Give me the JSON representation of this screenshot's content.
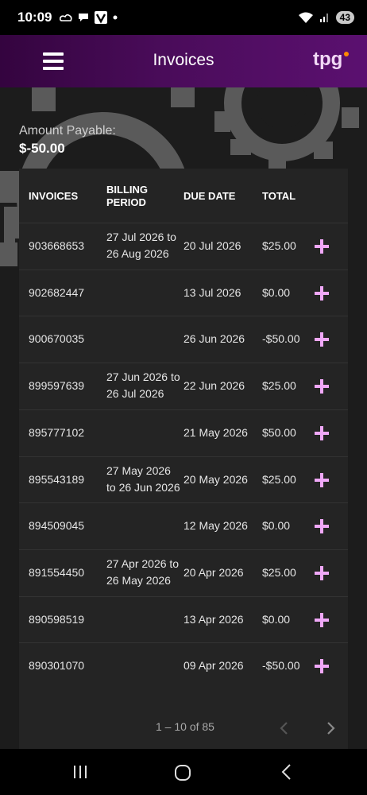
{
  "status": {
    "time": "10:09",
    "battery": "43"
  },
  "header": {
    "title": "Invoices",
    "logo_text": "tpg"
  },
  "summary": {
    "label": "Amount Payable:",
    "value": "$-50.00"
  },
  "table": {
    "headers": {
      "invoices": "INVOICES",
      "billing_line1": "BILLING",
      "billing_line2": "PERIOD",
      "due": "DUE DATE",
      "total": "TOTAL"
    },
    "rows": [
      {
        "invoice": "903668653",
        "period_line1": "27 Jul 2026 to",
        "period_line2": "26 Aug 2026",
        "due": "20 Jul 2026",
        "total": "$25.00"
      },
      {
        "invoice": "902682447",
        "period_line1": "",
        "period_line2": "",
        "due": "13 Jul 2026",
        "total": "$0.00"
      },
      {
        "invoice": "900670035",
        "period_line1": "",
        "period_line2": "",
        "due": "26 Jun 2026",
        "total": "-$50.00"
      },
      {
        "invoice": "899597639",
        "period_line1": "27 Jun 2026 to",
        "period_line2": "26 Jul 2026",
        "due": "22 Jun 2026",
        "total": "$25.00"
      },
      {
        "invoice": "895777102",
        "period_line1": "",
        "period_line2": "",
        "due": "21 May 2026",
        "total": "$50.00"
      },
      {
        "invoice": "895543189",
        "period_line1": "27 May 2026",
        "period_line2": "to 26 Jun 2026",
        "due": "20 May 2026",
        "total": "$25.00"
      },
      {
        "invoice": "894509045",
        "period_line1": "",
        "period_line2": "",
        "due": "12 May 2026",
        "total": "$0.00"
      },
      {
        "invoice": "891554450",
        "period_line1": "27 Apr 2026 to",
        "period_line2": "26 May 2026",
        "due": "20 Apr 2026",
        "total": "$25.00"
      },
      {
        "invoice": "890598519",
        "period_line1": "",
        "period_line2": "",
        "due": "13 Apr 2026",
        "total": "$0.00"
      },
      {
        "invoice": "890301070",
        "period_line1": "",
        "period_line2": "",
        "due": "09 Apr 2026",
        "total": "-$50.00"
      }
    ]
  },
  "pagination": {
    "range": "1 – 10 of 85"
  },
  "colors": {
    "accent_plus": "#f0a8f8",
    "header_bg": "#3a0747",
    "logo_dot": "#ff8a00"
  },
  "icons": [
    "menu-icon",
    "tpg-logo",
    "plus-icon",
    "chevron-left-icon",
    "chevron-right-icon",
    "recents-icon",
    "home-icon",
    "back-icon"
  ]
}
